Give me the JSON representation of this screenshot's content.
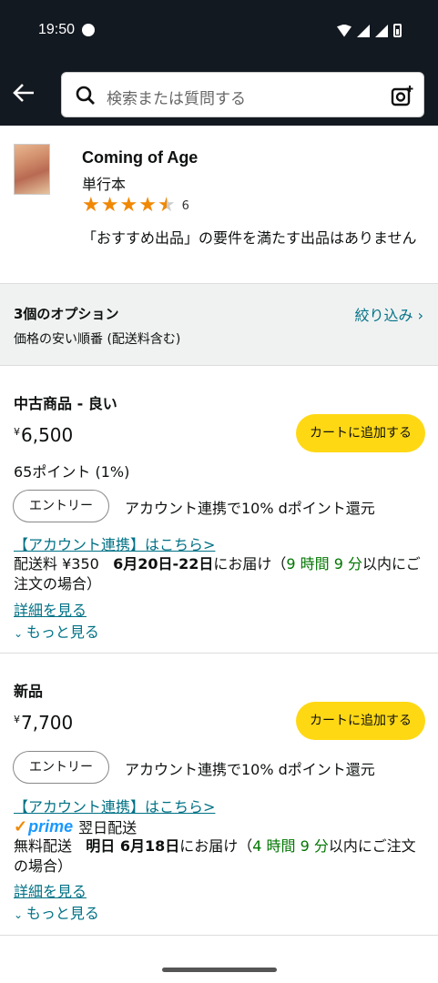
{
  "status": {
    "time": "19:50"
  },
  "search": {
    "placeholder": "検索または質問する"
  },
  "product": {
    "title": "Coming of Age",
    "format": "単行本",
    "rating_count": "6",
    "note": "「おすすめ出品」の要件を満たす出品はありません"
  },
  "options": {
    "count": "3個のオプション",
    "sort": "価格の安い順番 (配送料含む)",
    "filter": "絞り込み ›"
  },
  "offers": [
    {
      "condition": "中古商品 - 良い",
      "yen": "¥",
      "price": "6,500",
      "cart": "カートに追加する",
      "points": "65ポイント (1%)",
      "entry": "エントリー",
      "entry_text": "アカウント連携で10% dポイント還元",
      "link": "【アカウント連携】はこちら>",
      "ship_label": "配送料 ¥350",
      "ship_date": "6月20日-22日",
      "ship_mid": "にお届け（",
      "ship_time": "9 時間 9 分",
      "ship_end": "以内にご注文の場合）",
      "details": "詳細を見る",
      "more": "もっと見る"
    },
    {
      "condition": "新品",
      "yen": "¥",
      "price": "7,700",
      "cart": "カートに追加する",
      "entry": "エントリー",
      "entry_text": "アカウント連携で10% dポイント還元",
      "link": "【アカウント連携】はこちら>",
      "prime": "prime",
      "prime_text": "翌日配送",
      "ship_label": "無料配送",
      "ship_date": "明日 6月18日",
      "ship_mid": "にお届け（",
      "ship_time": "4 時間 9 分",
      "ship_end": "以内にご注文の場合）",
      "details": "詳細を見る",
      "more": "もっと見る"
    }
  ],
  "colors": {
    "header": "#131921",
    "cart": "#ffd814",
    "link": "#007185",
    "star": "#f08804",
    "green": "#007600"
  }
}
